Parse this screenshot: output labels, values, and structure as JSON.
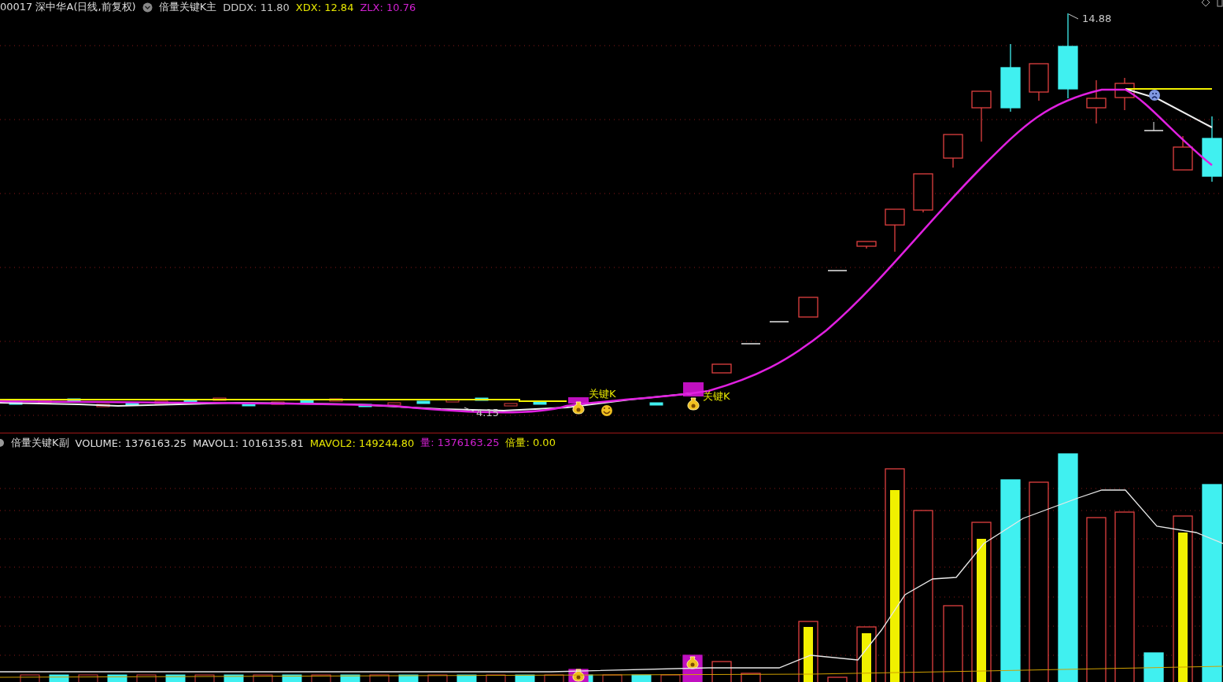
{
  "main_panel": {
    "title": "00017 深中华A(日线,前复权)",
    "indicator": "倍量关键K主",
    "values": [
      {
        "text": "DDDX: 11.80",
        "color": "#c8c8c8"
      },
      {
        "text": "XDX: 12.84",
        "color": "#e6e600"
      },
      {
        "text": "ZLX: 10.76",
        "color": "#d020d0"
      }
    ],
    "annotations": [
      {
        "text": "14.88",
        "kind": "price"
      },
      {
        "text": "4.15",
        "kind": "price"
      },
      {
        "text": "关键K",
        "kind": "signal"
      },
      {
        "text": "关键K",
        "kind": "signal"
      }
    ]
  },
  "sub_panel": {
    "indicator": "倍量关键K副",
    "values": [
      {
        "text": "VOLUME: 1376163.25",
        "color": "#e0e0e0"
      },
      {
        "text": "MAVOL1: 1016135.81",
        "color": "#e0e0e0"
      },
      {
        "text": "MAVOL2: 149244.80",
        "color": "#e6e600"
      },
      {
        "text": "量: 1376163.25",
        "color": "#d020d0"
      },
      {
        "text": "倍量: 0.00",
        "color": "#e6e600"
      }
    ]
  }
}
